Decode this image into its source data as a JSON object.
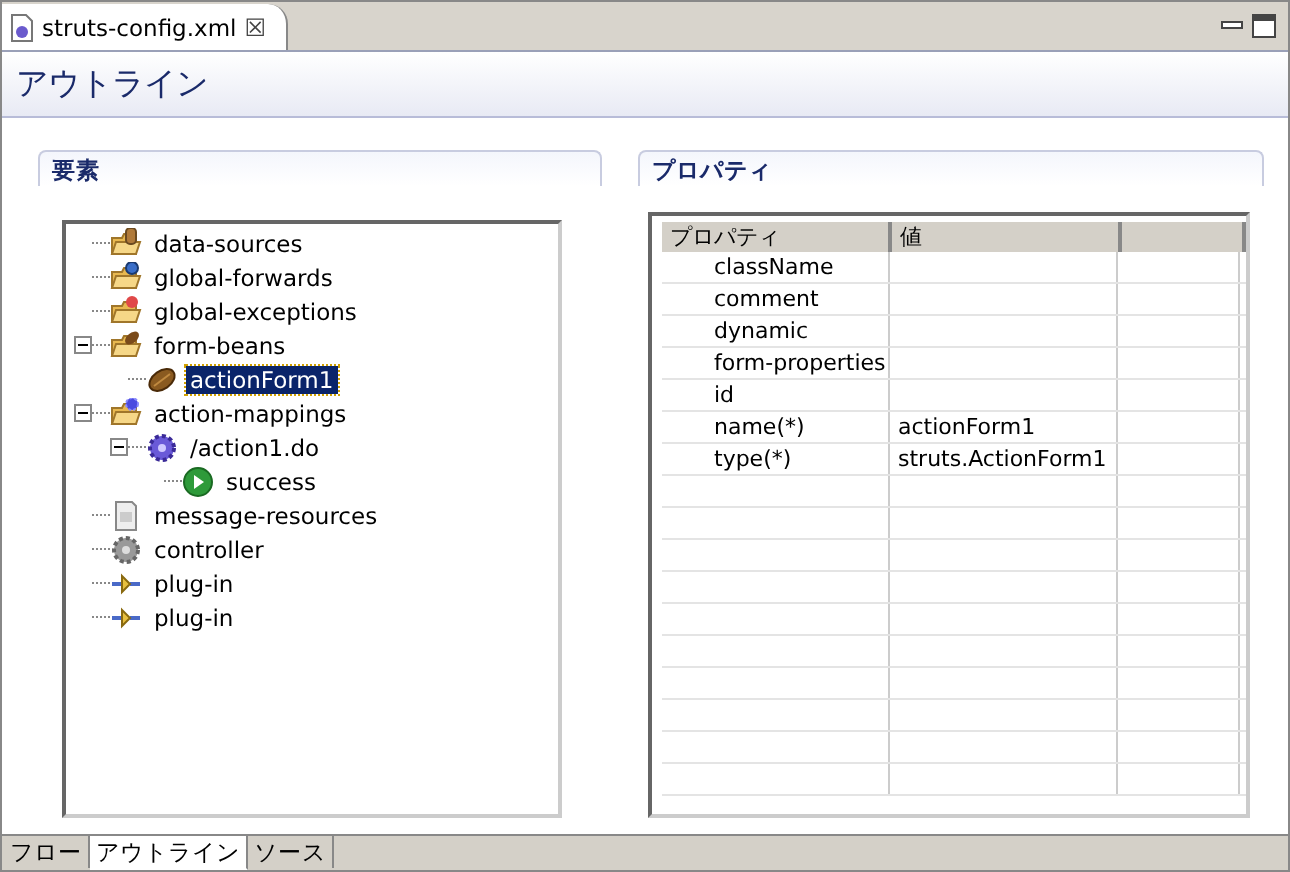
{
  "editor_tab": {
    "title": "struts-config.xml",
    "close": "☒"
  },
  "form_title": "アウトライン",
  "elements_section": {
    "title": "要素",
    "tree": [
      {
        "label": "data-sources",
        "kind": "folder-db",
        "selected": false
      },
      {
        "label": "global-forwards",
        "kind": "folder-globe",
        "selected": false
      },
      {
        "label": "global-exceptions",
        "kind": "folder-error",
        "selected": false
      },
      {
        "label": "form-beans",
        "kind": "folder-bean",
        "selected": false,
        "expanded": true,
        "children": [
          {
            "label": "actionForm1",
            "kind": "bean",
            "selected": true
          }
        ]
      },
      {
        "label": "action-mappings",
        "kind": "folder-gear",
        "selected": false,
        "expanded": true,
        "children": [
          {
            "label": "/action1.do",
            "kind": "gear",
            "selected": false,
            "expanded": true,
            "children": [
              {
                "label": "success",
                "kind": "play",
                "selected": false
              }
            ]
          }
        ]
      },
      {
        "label": "message-resources",
        "kind": "doc",
        "selected": false
      },
      {
        "label": "controller",
        "kind": "gear-grey",
        "selected": false
      },
      {
        "label": "plug-in",
        "kind": "plug",
        "selected": false
      },
      {
        "label": "plug-in",
        "kind": "plug",
        "selected": false
      }
    ]
  },
  "properties_section": {
    "title": "プロパティ",
    "columns": [
      "プロパティ",
      "値"
    ],
    "rows": [
      {
        "property": "className",
        "value": ""
      },
      {
        "property": "comment",
        "value": ""
      },
      {
        "property": "dynamic",
        "value": ""
      },
      {
        "property": "form-properties",
        "value": ""
      },
      {
        "property": "id",
        "value": ""
      },
      {
        "property": "name(*)",
        "value": "actionForm1"
      },
      {
        "property": "type(*)",
        "value": "struts.ActionForm1"
      }
    ]
  },
  "bottom_tabs": [
    {
      "label": "フロー",
      "selected": false
    },
    {
      "label": "アウトライン",
      "selected": true
    },
    {
      "label": "ソース",
      "selected": false
    }
  ]
}
